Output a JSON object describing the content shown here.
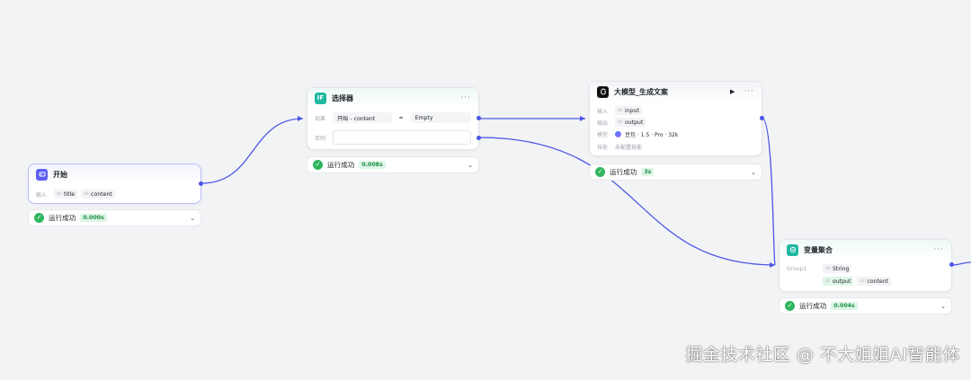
{
  "start": {
    "title": "开始",
    "input_label": "输入",
    "params": [
      {
        "type": "str",
        "name": "title"
      },
      {
        "type": "str",
        "name": "content"
      }
    ],
    "status": {
      "text": "运行成功",
      "time": "0.000s"
    }
  },
  "selector": {
    "title": "选择器",
    "cond_label": "如果",
    "else_label": "否则",
    "cond_left": "开始 - content",
    "cond_op": "=",
    "cond_right": "Empty",
    "status": {
      "text": "运行成功",
      "time": "0.008s"
    }
  },
  "llm": {
    "title": "大模型_生成文案",
    "input_label": "输入",
    "output_label": "输出",
    "model_label": "模型",
    "skill_label": "技能",
    "input_param": {
      "type": "str",
      "name": "input"
    },
    "output_param": {
      "type": "str",
      "name": "output"
    },
    "model_value": "豆包 · 1.5 · Pro · 32k",
    "skill_value": "未配置技能",
    "status": {
      "text": "运行成功",
      "time": "3s"
    }
  },
  "aggregator": {
    "title": "变量聚合",
    "group_label": "Group1",
    "group_type": {
      "type": "str",
      "name": "String"
    },
    "vars": [
      {
        "type": "str",
        "name": "output"
      },
      {
        "type": "str",
        "name": "content"
      }
    ],
    "status": {
      "text": "运行成功",
      "time": "0.004s"
    }
  },
  "icons": {
    "dots": "···",
    "check": "✓",
    "chevron": "⌄",
    "play": "▶"
  },
  "colors": {
    "accent": "#4c57e6",
    "success": "#2fb55d",
    "start_icon": "#5b5ff0",
    "selector_icon": "#1fb8a0",
    "aggregator_icon": "#1fb8a0"
  },
  "watermark": "掘金技术社区 @ 不大姐姐AI智能体"
}
